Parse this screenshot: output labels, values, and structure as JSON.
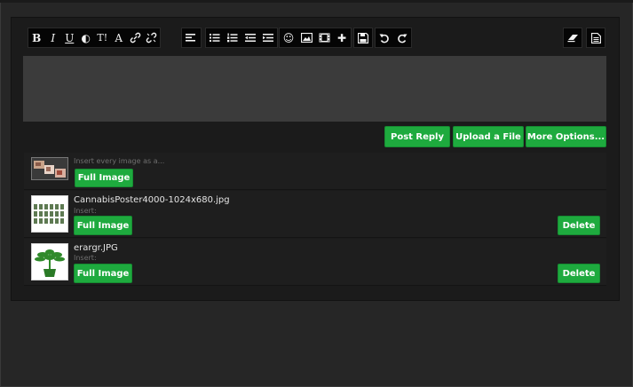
{
  "toolbar": {
    "bold": "B",
    "italic": "I",
    "underline": "U",
    "contrast": "◐",
    "text_size": "T!",
    "font_color": "A",
    "emoji": "☺",
    "add": "✚"
  },
  "actions": {
    "post_reply": "Post Reply",
    "upload_file": "Upload a File",
    "more_options": "More Options..."
  },
  "attachments": {
    "insert_every_label": "Insert every image as a...",
    "full_image_label": "Full Image",
    "items": [
      {
        "filename": "CannabisPoster4000-1024x680.jpg",
        "insert_label": "Insert:",
        "full_image": "Full Image",
        "delete": "Delete"
      },
      {
        "filename": "erargr.JPG",
        "insert_label": "Insert:",
        "full_image": "Full Image",
        "delete": "Delete"
      }
    ]
  },
  "colors": {
    "accent_green": "#1eaa3e",
    "panel_bg": "#1b1b1b",
    "editor_bg": "#3b3b3b",
    "page_bg": "#262626"
  }
}
